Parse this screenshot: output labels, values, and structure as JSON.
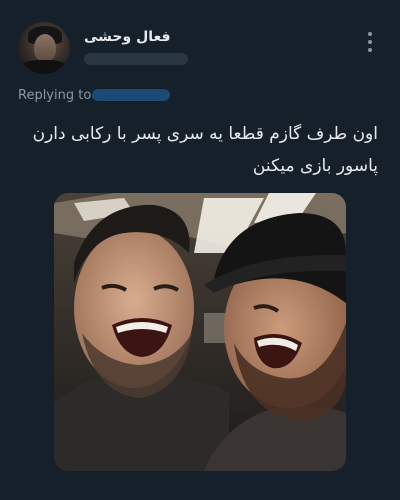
{
  "tweet": {
    "author_name": "فعال وحشی",
    "author_handle": "",
    "replying_to_label": "Replying to",
    "replying_to_handle": "",
    "text_line_1": "اون طرف گازم قطعا یه سری پسر با رکابی دارن",
    "text_line_2": "پاسور بازی میکنن"
  },
  "icons": {
    "more": "more-vertical-icon"
  },
  "colors": {
    "background": "#15202b",
    "primary_text": "#e7e9ea",
    "secondary_text": "#8b98a5",
    "link": "#1d9bf0"
  }
}
